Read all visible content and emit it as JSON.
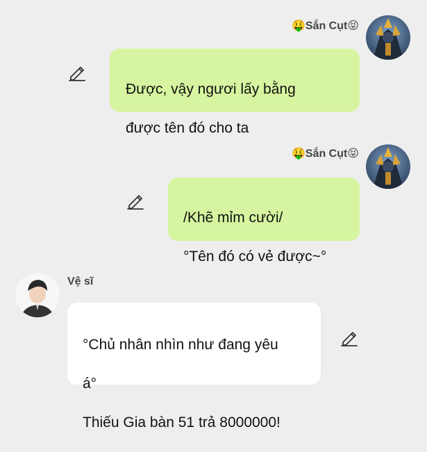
{
  "messages": [
    {
      "sender": "🤑Sắn Cụt😝",
      "lines": [
        "Được, vậy ngươi lấy bằng",
        "được tên đó cho ta"
      ]
    },
    {
      "sender": "🤑Sắn Cụt😝",
      "lines": [
        "/Khẽ mỉm cười/",
        "°Tên đó có vẻ được~°"
      ]
    },
    {
      "sender": "Vệ sĩ",
      "lines": [
        "°Chủ nhân nhìn như đang yêu",
        "á°",
        "Thiếu Gia bàn 51 trả 8000000!"
      ]
    }
  ],
  "icons": {
    "edit": "pencil-edit-icon",
    "emoji_left": "money-mouth-face",
    "emoji_right": "tongue-out-face"
  },
  "colors": {
    "background": "#eeeeee",
    "bubble_self": "#d7f5a0",
    "bubble_other": "#ffffff",
    "text": "#111111"
  }
}
